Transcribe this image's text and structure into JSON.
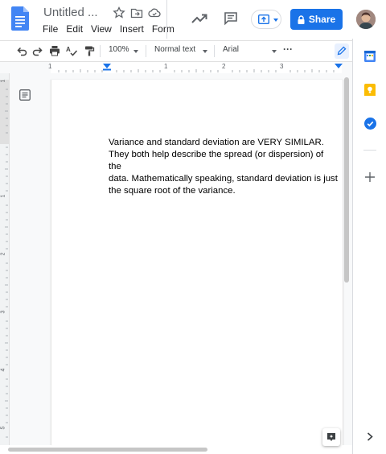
{
  "header": {
    "doc_title": "Untitled ...",
    "menu": [
      "File",
      "Edit",
      "View",
      "Insert",
      "Form"
    ],
    "share_label": "Share"
  },
  "toolbar": {
    "zoom": "100%",
    "style": "Normal text",
    "font": "Arial",
    "more": "···"
  },
  "ruler": {
    "marks": [
      "1",
      "1",
      "2",
      "3"
    ]
  },
  "vertical_ruler": {
    "marks": [
      "1",
      "1",
      "2",
      "3",
      "4",
      "5"
    ]
  },
  "document": {
    "body": "Variance and standard deviation are VERY SIMILAR.\nThey both help describe the spread (or dispersion) of the\ndata.  Mathematically speaking, standard deviation is just\nthe square root of the variance."
  },
  "colors": {
    "accent": "#1a73e8",
    "docs_blue": "#4285f4",
    "keep_yellow": "#fbbc04",
    "tasks_blue": "#1a73e8"
  },
  "icons": [
    "docs-logo-icon",
    "star-icon",
    "move-folder-icon",
    "cloud-icon",
    "trending-icon",
    "comment-icon",
    "present-icon",
    "lock-icon",
    "undo-icon",
    "redo-icon",
    "print-icon",
    "spellcheck-icon",
    "paint-format-icon",
    "pencil-icon",
    "outline-icon",
    "calendar-icon",
    "keep-icon",
    "tasks-icon",
    "plus-icon",
    "chevron-right-icon",
    "explore-icon"
  ]
}
